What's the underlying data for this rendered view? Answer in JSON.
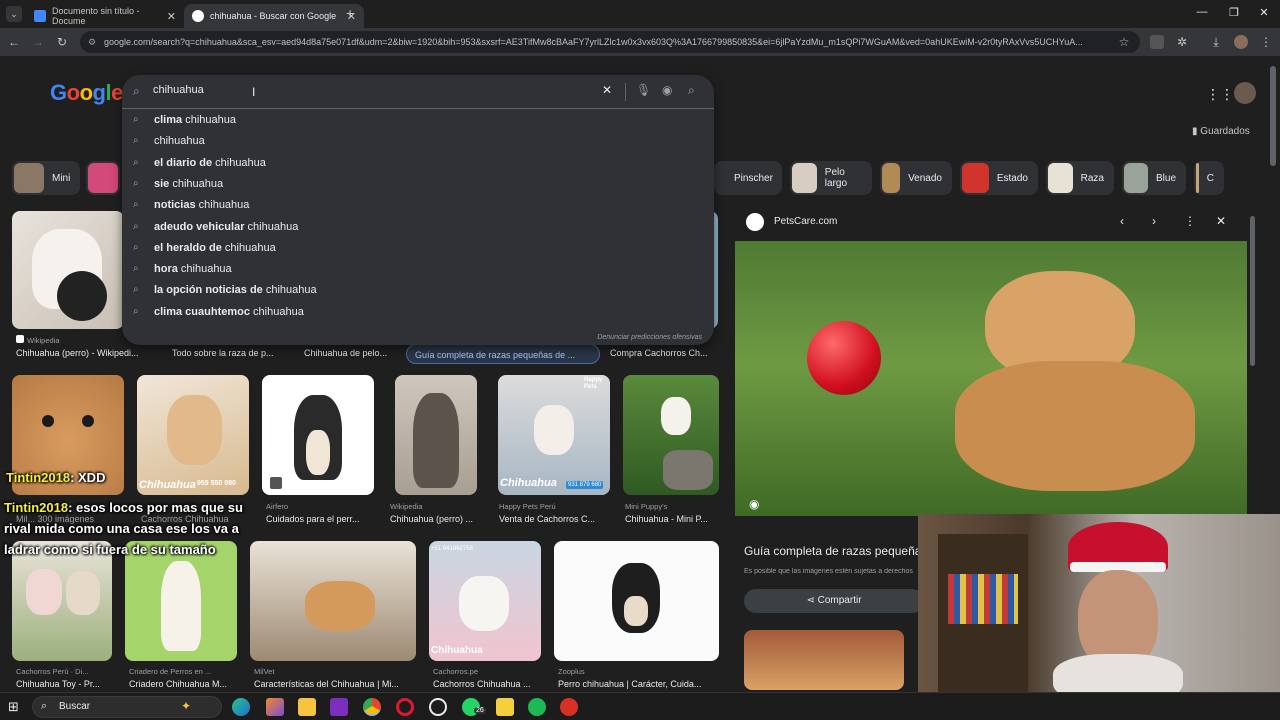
{
  "tabs": [
    {
      "title": "Documento sin título - Docume",
      "favicon_color": "#4285f4"
    },
    {
      "title": "chihuahua - Buscar con Google",
      "favicon_color": "#e8eaed"
    }
  ],
  "window": {
    "new_tab": "+",
    "minimize": "—",
    "restore": "❐",
    "close": "✕"
  },
  "url": "google.com/search?q=chihuahua&sca_esv=aed94d8a75e071df&udm=2&biw=1920&bih=953&sxsrf=AE3TifMw8cBAaFY7yrlLZlc1w0x3vx603Q%3A1766799850835&ei=6jlPaYzdMu_m1sQPi7WGuAM&ved=0ahUKEwiM-v2r0tyRAxVvs5UCHYuA...",
  "logo": "Google",
  "search": {
    "query": "chihuahua",
    "suggestions": [
      {
        "bold": "clima",
        "rest": " chihuahua"
      },
      {
        "bold": "",
        "rest": "chihuahua"
      },
      {
        "bold": "el diario de",
        "rest": " chihuahua"
      },
      {
        "bold": "sie",
        "rest": " chihuahua"
      },
      {
        "bold": "noticias",
        "rest": " chihuahua"
      },
      {
        "bold": "adeudo vehicular",
        "rest": " chihuahua"
      },
      {
        "bold": "el heraldo de",
        "rest": " chihuahua"
      },
      {
        "bold": "hora",
        "rest": " chihuahua"
      },
      {
        "bold": "la opción noticias de",
        "rest": " chihuahua"
      },
      {
        "bold": "clima cuauhtemoc",
        "rest": " chihuahua"
      }
    ],
    "report": "Denunciar predicciones ofensivas"
  },
  "saved": "Guardados",
  "chips_left": [
    "Mini"
  ],
  "chips_right": [
    "Pinscher",
    "Pelo largo",
    "Venado",
    "Estado",
    "Raza",
    "Blue",
    "C"
  ],
  "row1_captions": [
    {
      "source": "Wikipedia",
      "title": "Chihuahua (perro) - Wikipedi..."
    },
    {
      "source": "",
      "title": "Todo sobre la raza de p..."
    },
    {
      "source": "",
      "title": "Chihuahua de pelo..."
    },
    {
      "source": "",
      "title": "Guía completa de razas pequeñas de ..."
    },
    {
      "source": "",
      "title": "Compra Cachorros Ch..."
    }
  ],
  "row2_captions": [
    {
      "source": "",
      "title": "Mil... 300 imágenes"
    },
    {
      "source": "",
      "title": "Cachorros Chihuahua"
    },
    {
      "source": "Airfero",
      "title": "Cuidados para el perr..."
    },
    {
      "source": "Wikipedia",
      "title": "Chihuahua (perro) ..."
    },
    {
      "source": "Happy Pets Perú",
      "title": "Venta de Cachorros C..."
    },
    {
      "source": "Mini Puppy's",
      "title": "Chihuahua - Mini P..."
    }
  ],
  "row3_captions": [
    {
      "source": "Cachorros Perú · Di...",
      "title": "Chihuahua Toy - Pr..."
    },
    {
      "source": "Criadero de Perros en ...",
      "title": "Criadero Chihuahua M..."
    },
    {
      "source": "MilVet",
      "title": "Características del Chihuahua | Mi..."
    },
    {
      "source": "Cachorros.pe",
      "title": "Cachorros Chihuahua ..."
    },
    {
      "source": "Zooplus",
      "title": "Perro chihuahua | Carácter, Cuida..."
    }
  ],
  "image_overlays": {
    "phone": "955 550 080",
    "brand": "Chihuahua",
    "happy": "Happy Pets",
    "phone2": "931 879 680",
    "phone3": "+51 941862758"
  },
  "panel": {
    "site": "PetsCare.com",
    "title": "Guía completa de razas pequeñas",
    "note": "Es posible que las imágenes estén sujetas a derechos",
    "share": "Compartir"
  },
  "chat": [
    {
      "user": "Tintin2018",
      "msg": ": XDD"
    },
    {
      "user": "Tintin2018",
      "msg": ": esos locos por mas que su rival mida como una casa ese los va a ladrar como si fuera de su tamaño"
    }
  ],
  "taskbar": {
    "search": "Buscar",
    "whatsapp_badge": "26"
  }
}
